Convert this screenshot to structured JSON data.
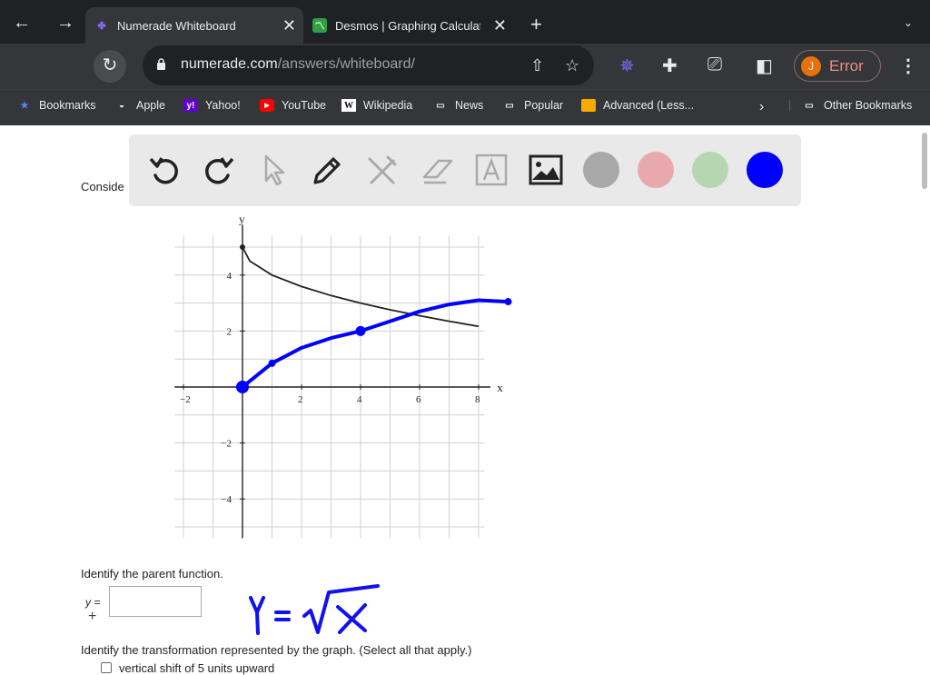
{
  "tabs": [
    {
      "title": "Numerade Whiteboard",
      "active": true,
      "favicon": "numerade-icon"
    },
    {
      "title": "Desmos | Graphing Calculato",
      "active": false,
      "favicon": "desmos-icon"
    }
  ],
  "address": {
    "host": "numerade.com",
    "path": "/answers/whiteboard/"
  },
  "profile": {
    "initial": "J",
    "status": "Error"
  },
  "bookmarks": [
    {
      "label": "Bookmarks",
      "icon": "star-icon"
    },
    {
      "label": "Apple",
      "icon": "apple-icon"
    },
    {
      "label": "Yahoo!",
      "icon": "yahoo-icon"
    },
    {
      "label": "YouTube",
      "icon": "youtube-icon"
    },
    {
      "label": "Wikipedia",
      "icon": "wikipedia-icon"
    },
    {
      "label": "News",
      "icon": "folder-icon"
    },
    {
      "label": "Popular",
      "icon": "folder-icon"
    },
    {
      "label": "Advanced (Less...",
      "icon": "bookmark-icon"
    }
  ],
  "other_bookmarks": "Other Bookmarks",
  "toolbar": {
    "tools": [
      "undo-icon",
      "redo-icon",
      "pointer-icon",
      "pen-icon",
      "tools-icon",
      "eraser-icon",
      "text-icon",
      "image-icon"
    ],
    "colors": [
      "#a8a8a8",
      "#e8a9ae",
      "#b5d6b0",
      "#0000ff"
    ]
  },
  "question": {
    "consider_text": "Conside",
    "identify_parent": "Identify the parent function.",
    "y_equals": "y =",
    "plus": "+",
    "identify_transformation": "Identify the transformation represented by the graph. (Select all that apply.)",
    "option1": "vertical shift of 5 units upward"
  },
  "chart_data": {
    "type": "line",
    "xlabel": "x",
    "ylabel": "y",
    "xlim": [
      -2,
      8.5
    ],
    "ylim": [
      -5.5,
      6
    ],
    "x_ticks": [
      "−2",
      "2",
      "4",
      "6",
      "8"
    ],
    "y_ticks": [
      "4",
      "2",
      "−2",
      "−4"
    ],
    "grid": true,
    "series": [
      {
        "color": "#222222",
        "points": [
          [
            0,
            5
          ],
          [
            0.25,
            4.5
          ],
          [
            1,
            4
          ],
          [
            2,
            3.59
          ],
          [
            3,
            3.27
          ],
          [
            4,
            3
          ],
          [
            5,
            2.76
          ],
          [
            6,
            2.55
          ],
          [
            7,
            2.35
          ],
          [
            8,
            2.17
          ]
        ]
      },
      {
        "color": "#0000ff",
        "points": [
          [
            0,
            0
          ],
          [
            1,
            0.85
          ],
          [
            2,
            1.4
          ],
          [
            3,
            1.75
          ],
          [
            4,
            2
          ],
          [
            5,
            2.35
          ],
          [
            6,
            2.7
          ],
          [
            7,
            2.95
          ],
          [
            8,
            3.1
          ],
          [
            9,
            3.05
          ]
        ]
      }
    ],
    "annotation_handwritten": "Y = √x"
  }
}
